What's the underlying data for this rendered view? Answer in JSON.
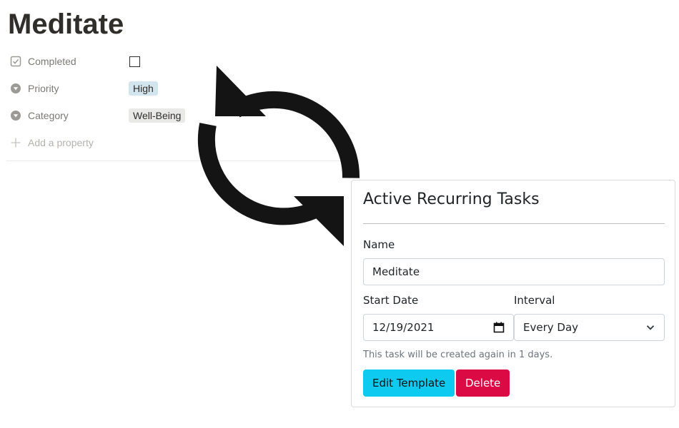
{
  "page": {
    "title": "Meditate"
  },
  "properties": [
    {
      "name": "Completed",
      "icon": "checkbox-icon",
      "type": "checkbox",
      "checked": false
    },
    {
      "name": "Priority",
      "icon": "select-icon",
      "type": "tag",
      "value": "High",
      "color": "#d3e5ef"
    },
    {
      "name": "Category",
      "icon": "select-icon",
      "type": "tag",
      "value": "Well-Being",
      "color": "#e9e9e7"
    }
  ],
  "add_property_label": "Add a property",
  "overlay_icon": "refresh-icon",
  "recurring_card": {
    "title": "Active Recurring Tasks",
    "name_label": "Name",
    "name_value": "Meditate",
    "start_date_label": "Start Date",
    "start_date_value": "12/19/2021",
    "interval_label": "Interval",
    "interval_value": "Every Day",
    "help_text": "This task will be created again in 1 days.",
    "edit_button": "Edit Template",
    "delete_button": "Delete"
  },
  "colors": {
    "edit_button": "#0dcaf0",
    "delete_button": "#dc0a44"
  }
}
